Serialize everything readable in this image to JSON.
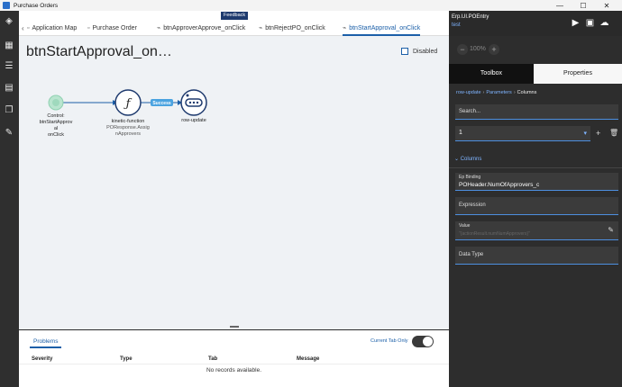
{
  "window": {
    "title": "Purchase Orders",
    "min": "—",
    "max": "☐",
    "close": "✕"
  },
  "feedback_label": "Feedback",
  "tabs": [
    {
      "label": "Application Map"
    },
    {
      "label": "Purchase Order"
    },
    {
      "label": "btnApproverApprove_onClick"
    },
    {
      "label": "btnRejectPO_onClick"
    },
    {
      "label": "btnStartApproval_onClick",
      "active": true
    }
  ],
  "canvas": {
    "title": "btnStartApproval_on…",
    "disabled_label": "Disabled",
    "nodes": {
      "start": {
        "line1": "Control:",
        "line2": "btnStartApprov",
        "line3": "al",
        "line4": "onClick"
      },
      "func": {
        "line1": "kinetic-function",
        "line2": "POResponse.Assig",
        "line3": "nApprovers"
      },
      "row": {
        "line1": "row-update"
      }
    },
    "edge_label": "Success"
  },
  "problems": {
    "tab_label": "Problems",
    "current_tab_only": "Current Tab Only",
    "columns": [
      "Severity",
      "Type",
      "Tab",
      "Message"
    ],
    "empty_text": "No records available."
  },
  "right": {
    "app_id": "Erp.UI.POEntry",
    "layer": "test",
    "zoom_value": "100%",
    "tabs": {
      "toolbox": "Toolbox",
      "properties": "Properties"
    },
    "breadcrumb": {
      "a": "row-update",
      "b": "Parameters",
      "c": "Columns"
    },
    "search_placeholder": "Search...",
    "column_index": "1",
    "section": "Columns",
    "ep_binding_label": "Ep Binding",
    "ep_binding_value": "POHeader.NumOfApprovers_c",
    "expression_label": "Expression",
    "value_label": "Value",
    "value_placeholder": "\"{actionResult.numNumApprovers}\"",
    "data_type_label": "Data Type"
  }
}
